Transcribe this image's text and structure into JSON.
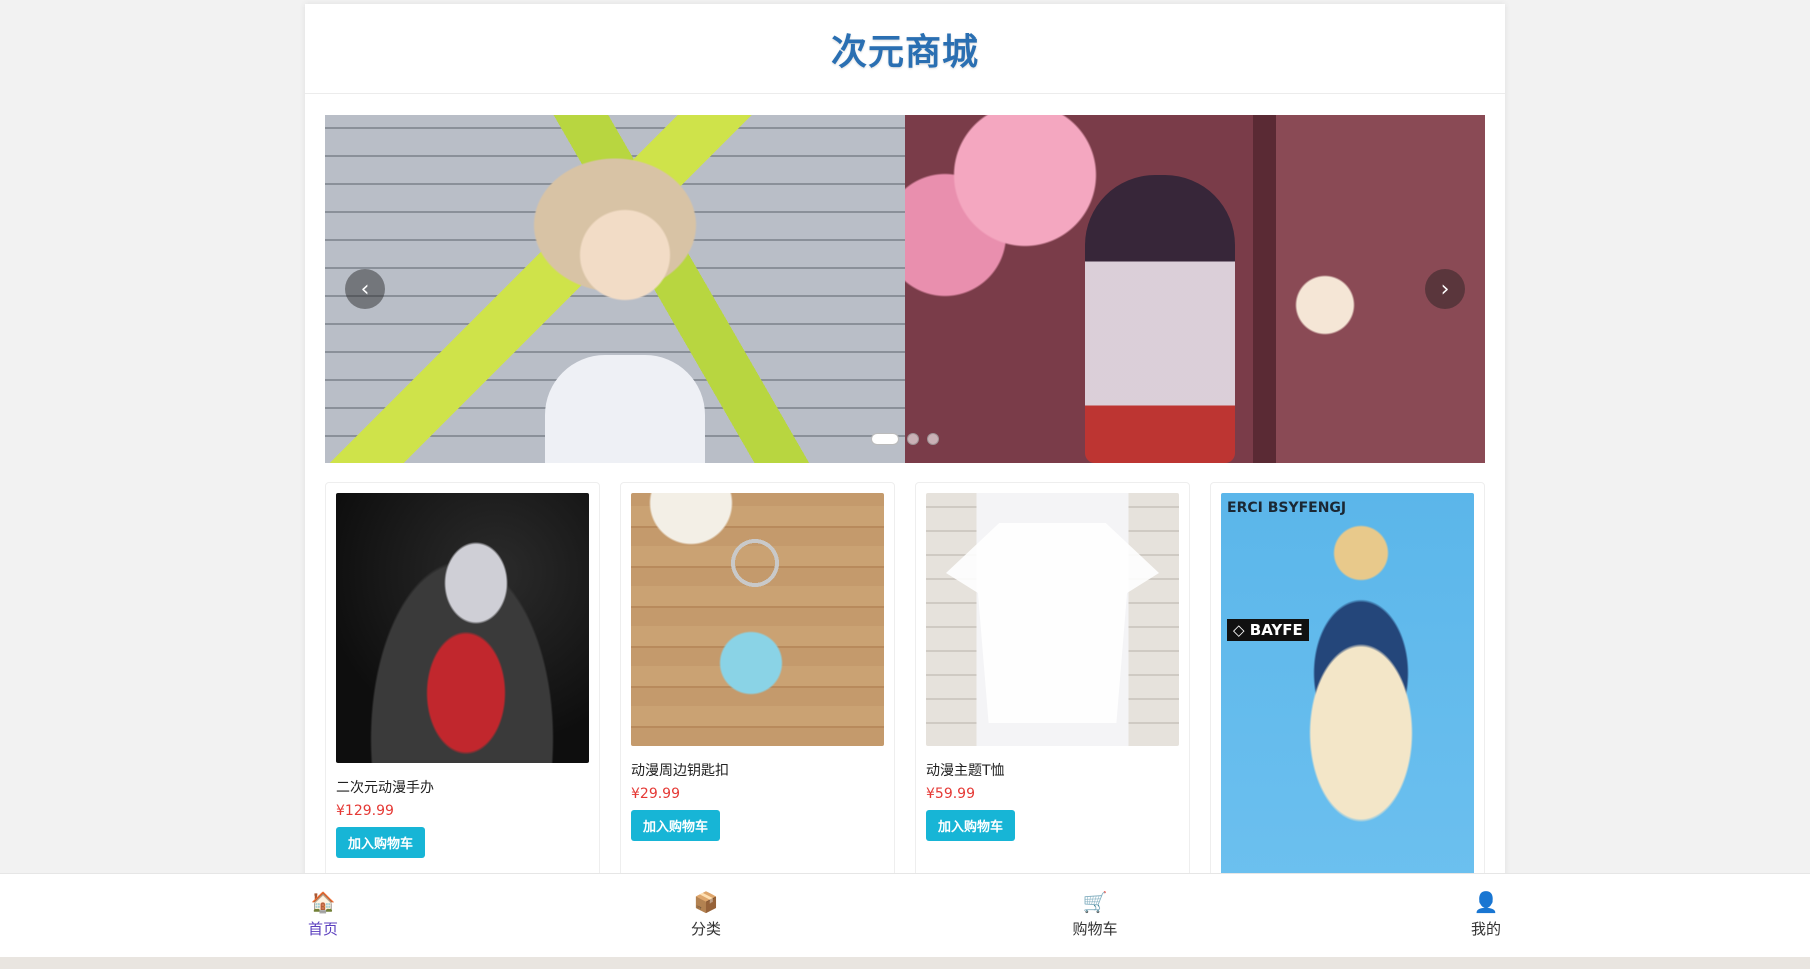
{
  "header": {
    "title": "次元商城"
  },
  "carousel": {
    "prev_icon": "‹",
    "next_icon": "›",
    "slide_count": 3,
    "active_index": 0
  },
  "products": [
    {
      "name": "二次元动漫手办",
      "price": "¥129.99",
      "button": "加入购物车"
    },
    {
      "name": "动漫周边钥匙扣",
      "price": "¥29.99",
      "button": "加入购物车"
    },
    {
      "name": "动漫主题T恤",
      "price": "¥59.99",
      "button": "加入购物车"
    },
    {
      "image_text": "ERCI BSYFENGJ",
      "image_badge": "◇ BAYFE"
    }
  ],
  "bottom_nav": {
    "items": [
      {
        "label": "首页",
        "icon": "house-icon",
        "glyph": "🏠",
        "active": true
      },
      {
        "label": "分类",
        "icon": "box-icon",
        "glyph": "📦",
        "active": false
      },
      {
        "label": "购物车",
        "icon": "cart-icon",
        "glyph": "🛒",
        "active": false
      },
      {
        "label": "我的",
        "icon": "user-icon",
        "glyph": "👤",
        "active": false
      }
    ]
  },
  "colors": {
    "title": "#2a6fb2",
    "price": "#e53935",
    "button": "#17b5d6",
    "nav_active": "#5b3fbf"
  }
}
